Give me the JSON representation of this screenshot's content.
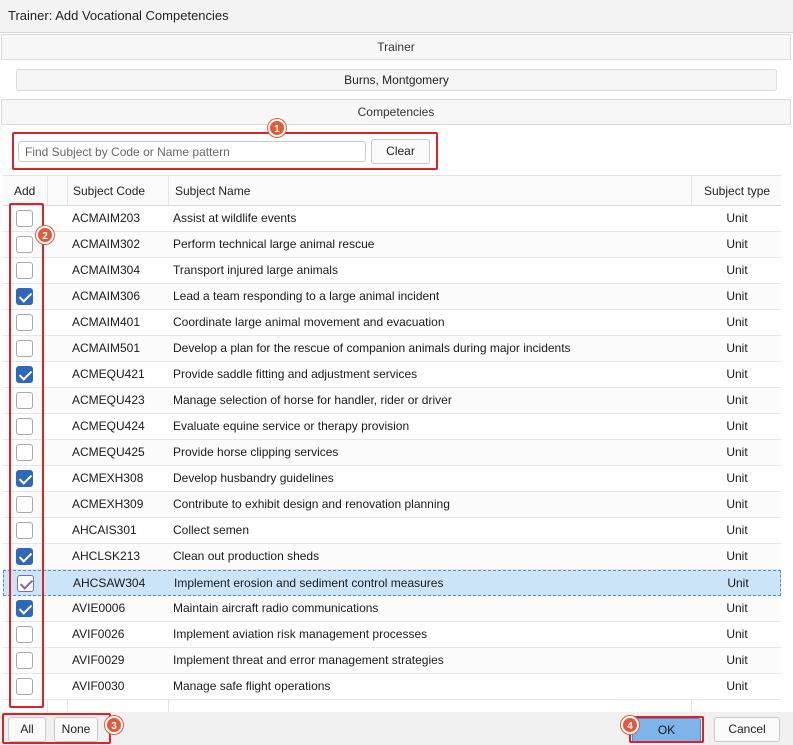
{
  "window": {
    "title": "Trainer: Add Vocational Competencies"
  },
  "trainer": {
    "section_label": "Trainer",
    "name": "Burns, Montgomery"
  },
  "competencies": {
    "section_label": "Competencies",
    "search_placeholder": "Find Subject by Code or Name pattern",
    "search_value": "",
    "clear_label": "Clear"
  },
  "grid": {
    "headers": {
      "add": "Add",
      "code": "Subject Code",
      "name": "Subject Name",
      "type": "Subject type"
    },
    "rows": [
      {
        "checked": false,
        "code": "ACMAIM203",
        "name": "Assist at wildlife events",
        "type": "Unit"
      },
      {
        "checked": false,
        "code": "ACMAIM302",
        "name": "Perform technical large animal rescue",
        "type": "Unit"
      },
      {
        "checked": false,
        "code": "ACMAIM304",
        "name": "Transport injured large animals",
        "type": "Unit"
      },
      {
        "checked": true,
        "code": "ACMAIM306",
        "name": "Lead a team responding to a large animal incident",
        "type": "Unit"
      },
      {
        "checked": false,
        "code": "ACMAIM401",
        "name": "Coordinate large animal movement and evacuation",
        "type": "Unit"
      },
      {
        "checked": false,
        "code": "ACMAIM501",
        "name": "Develop a plan for the rescue of companion animals during major incidents",
        "type": "Unit"
      },
      {
        "checked": true,
        "code": "ACMEQU421",
        "name": "Provide saddle fitting and adjustment services",
        "type": "Unit"
      },
      {
        "checked": false,
        "code": "ACMEQU423",
        "name": "Manage selection of horse for handler, rider or driver",
        "type": "Unit"
      },
      {
        "checked": false,
        "code": "ACMEQU424",
        "name": "Evaluate equine service or therapy provision",
        "type": "Unit"
      },
      {
        "checked": false,
        "code": "ACMEQU425",
        "name": "Provide horse clipping services",
        "type": "Unit"
      },
      {
        "checked": true,
        "code": "ACMEXH308",
        "name": "Develop husbandry guidelines",
        "type": "Unit"
      },
      {
        "checked": false,
        "code": "ACMEXH309",
        "name": "Contribute to exhibit design and renovation planning",
        "type": "Unit"
      },
      {
        "checked": false,
        "code": "AHCAIS301",
        "name": "Collect semen",
        "type": "Unit"
      },
      {
        "checked": true,
        "code": "AHCLSK213",
        "name": "Clean out production sheds",
        "type": "Unit"
      },
      {
        "checked": true,
        "selected": true,
        "code": "AHCSAW304",
        "name": "Implement erosion and sediment control measures",
        "type": "Unit"
      },
      {
        "checked": true,
        "code": "AVIE0006",
        "name": "Maintain aircraft radio communications",
        "type": "Unit"
      },
      {
        "checked": false,
        "code": "AVIF0026",
        "name": "Implement aviation risk management processes",
        "type": "Unit"
      },
      {
        "checked": false,
        "code": "AVIF0029",
        "name": "Implement threat and error management strategies",
        "type": "Unit"
      },
      {
        "checked": false,
        "code": "AVIF0030",
        "name": "Manage safe flight operations",
        "type": "Unit"
      }
    ]
  },
  "footer": {
    "all_label": "All",
    "none_label": "None",
    "ok_label": "OK",
    "cancel_label": "Cancel"
  },
  "markers": {
    "m1": "1",
    "m2": "2",
    "m3": "3",
    "m4": "4"
  },
  "colors": {
    "marker": "#e3593b",
    "highlight_outline": "#d8232a",
    "checkbox_checked": "#2f68b8",
    "selected_row": "#cce4f7"
  }
}
